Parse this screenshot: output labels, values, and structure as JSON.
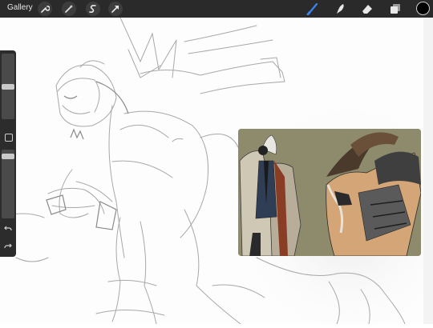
{
  "toolbar": {
    "gallery_label": "Gallery",
    "left_tools": [
      {
        "icon": "wrench-icon"
      },
      {
        "icon": "magic-wand-icon"
      },
      {
        "icon": "selection-icon"
      },
      {
        "icon": "transform-arrow-icon"
      }
    ],
    "right_tools": [
      {
        "icon": "brush-icon",
        "color": "#3b82f6"
      },
      {
        "icon": "smudge-icon",
        "color": "#e8e8e8"
      },
      {
        "icon": "eraser-icon",
        "color": "#e8e8e8"
      },
      {
        "icon": "layers-icon",
        "color": "#e8e8e8"
      }
    ],
    "active_color": "#000000"
  },
  "sidebar": {
    "brush_size_level": 0.55,
    "opacity_level": 0.95,
    "undo_icon": "undo-icon",
    "redo_icon": "redo-icon"
  },
  "colors": {
    "topbar": "#2a2a2a",
    "sidebar": "#2c2c2c",
    "reference_bg": "#8e8b6c"
  }
}
